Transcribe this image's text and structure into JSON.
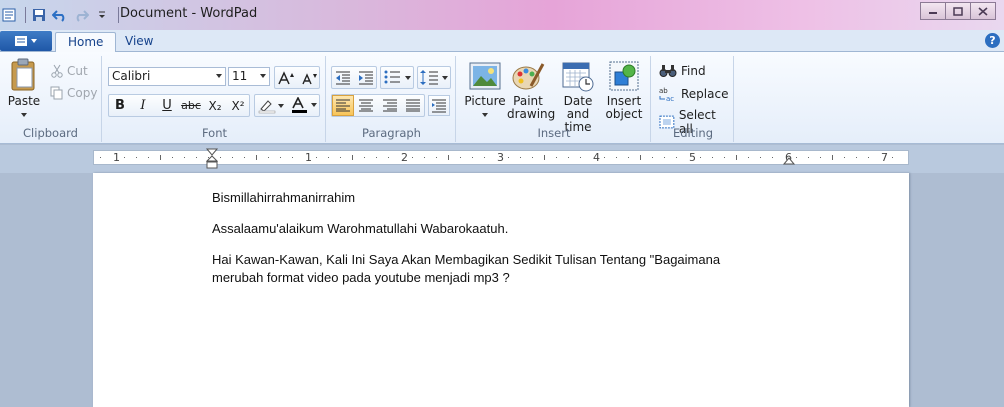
{
  "window": {
    "title": "Document - WordPad",
    "controls": [
      "minimize",
      "maximize",
      "close"
    ]
  },
  "quick_access": [
    "save-icon",
    "undo-icon",
    "redo-icon",
    "customize-icon"
  ],
  "tabs": [
    {
      "label": "Home",
      "active": true
    },
    {
      "label": "View",
      "active": false
    }
  ],
  "ribbon": {
    "clipboard": {
      "label": "Clipboard",
      "paste": "Paste",
      "cut": "Cut",
      "copy": "Copy"
    },
    "font": {
      "label": "Font",
      "family": "Calibri",
      "size": "11",
      "bold": "B",
      "italic": "I",
      "underline": "U",
      "strike": "abc",
      "subscript": "X₂",
      "superscript": "X²"
    },
    "paragraph": {
      "label": "Paragraph",
      "alignment": "left"
    },
    "insert": {
      "label": "Insert",
      "picture": "Picture",
      "paint_drawing_1": "Paint",
      "paint_drawing_2": "drawing",
      "date_time_1": "Date and",
      "date_time_2": "time",
      "insert_object_1": "Insert",
      "insert_object_2": "object"
    },
    "editing": {
      "label": "Editing",
      "find": "Find",
      "replace": "Replace",
      "select_all": "Select all"
    }
  },
  "ruler": {
    "numbers": [
      "1",
      "1",
      "2",
      "3",
      "4",
      "5",
      "6",
      "7"
    ]
  },
  "document": {
    "line1": "Bismillahirrahmanirrahim",
    "line2": "Assalaamu'alaikum Warohmatullahi Wabarokaatuh.",
    "line3": "Hai Kawan-Kawan, Kali Ini Saya Akan Membagikan Sedikit Tulisan Tentang \"Bagaimana",
    "line4": "merubah format video pada youtube menjadi mp3 ?"
  }
}
